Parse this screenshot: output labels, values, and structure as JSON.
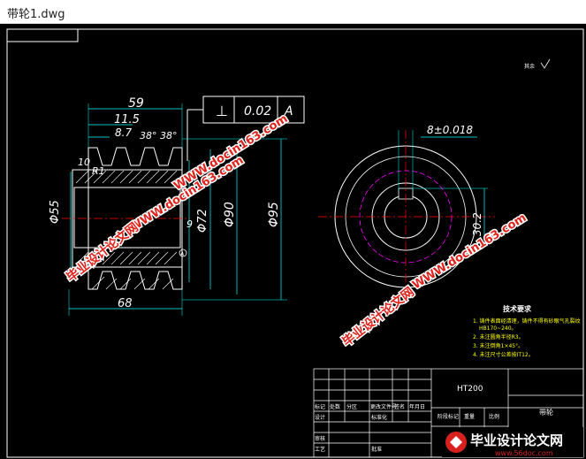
{
  "window": {
    "title": "带轮1.dwg"
  },
  "colors": {
    "background": "#000000",
    "line": "#ffffff",
    "cyan": "#00ffff",
    "magenta": "#ff00ff",
    "red": "#ff0000",
    "yellow": "#ffff00",
    "watermark": "#e0231c"
  },
  "drawing": {
    "roughness_mark": "其余",
    "tolerance_frame": {
      "symbol": "⊥",
      "value": "0.02",
      "datum": "A"
    },
    "dims_front": {
      "d59": "59",
      "d11_5": "11.5",
      "d8_7": "8.7",
      "angle": "38°",
      "angle2": "38°",
      "d10": "10",
      "r1": "R1",
      "phi55": "Φ55",
      "phi72": "Φ72",
      "phi90": "Φ90",
      "phi95": "Φ95",
      "d9": "9",
      "d68": "68",
      "datum_a": "A"
    },
    "dims_side": {
      "keyway": "8±0.018",
      "key_depth": "30.2"
    },
    "tech_req": {
      "title": "技术要求",
      "items": [
        "1. 铸件表面经清理，铸件不得有砂眼气孔裂纹",
        "HB170~240。",
        "2. 未注圆角半径R3。",
        "3. 未注倒角1×45°。",
        "4. 未注尺寸公差按IT12。"
      ]
    },
    "title_block": {
      "material": "HT200",
      "part_name": "带轮",
      "cells": [
        "标记",
        "处数",
        "分区",
        "更改文件号",
        "签名",
        "年月日",
        "设计",
        "标准化",
        "阶段标记",
        "重量",
        "比例",
        "审核",
        "工艺",
        "批准"
      ]
    }
  },
  "watermarks": {
    "url1": "WWW.docin163.com",
    "cn1": "毕业设计论文网",
    "url2": "WWW.docin163.com",
    "cn2": "毕业设计论文网",
    "url3": "WWW.docin163.com",
    "cn3": "毕业设计论文网"
  },
  "logo": {
    "title": "毕业设计论文网",
    "url": "www.56doc.com"
  }
}
